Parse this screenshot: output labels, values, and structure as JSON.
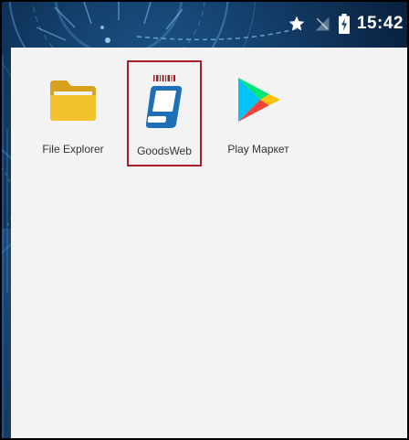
{
  "status_bar": {
    "time": "15:42",
    "icons": [
      "star-icon",
      "no-sim-icon",
      "battery-charging-icon"
    ]
  },
  "colors": {
    "drawer_background": "#f3f3f3",
    "selection_outline": "#a81e24",
    "label_text": "#333333",
    "folder_yellow": "#f2c12e",
    "goodsweb_blue": "#1d6fb8",
    "wallpaper_blue": "#14416e"
  },
  "apps": [
    {
      "label": "File Explorer",
      "icon": "folder-icon",
      "selected": false
    },
    {
      "label": "GoodsWeb",
      "icon": "goodsweb-scanner-icon",
      "selected": true
    },
    {
      "label": "Play Маркет",
      "icon": "play-store-icon",
      "selected": false
    }
  ]
}
